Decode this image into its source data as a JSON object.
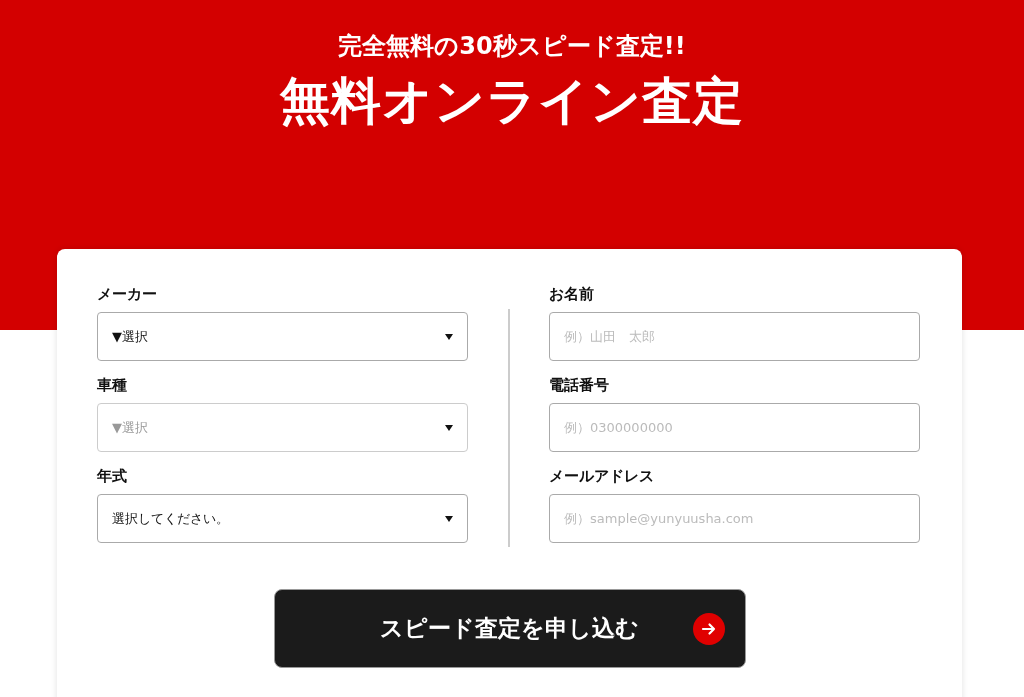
{
  "header": {
    "subtitle": "完全無料の30秒スピード査定!!",
    "title": "無料オンライン査定"
  },
  "left_fields": [
    {
      "label": "メーカー",
      "value": "▼選択",
      "disabled": false
    },
    {
      "label": "車種",
      "value": "▼選択",
      "disabled": true
    },
    {
      "label": "年式",
      "value": "選択してください。",
      "disabled": false
    }
  ],
  "right_fields": [
    {
      "label": "お名前",
      "placeholder": "例）山田　太郎"
    },
    {
      "label": "電話番号",
      "placeholder": "例）0300000000"
    },
    {
      "label": "メールアドレス",
      "placeholder": "例）sample@yunyuusha.com"
    }
  ],
  "submit_button": {
    "label": "スピード査定を申し込む"
  }
}
